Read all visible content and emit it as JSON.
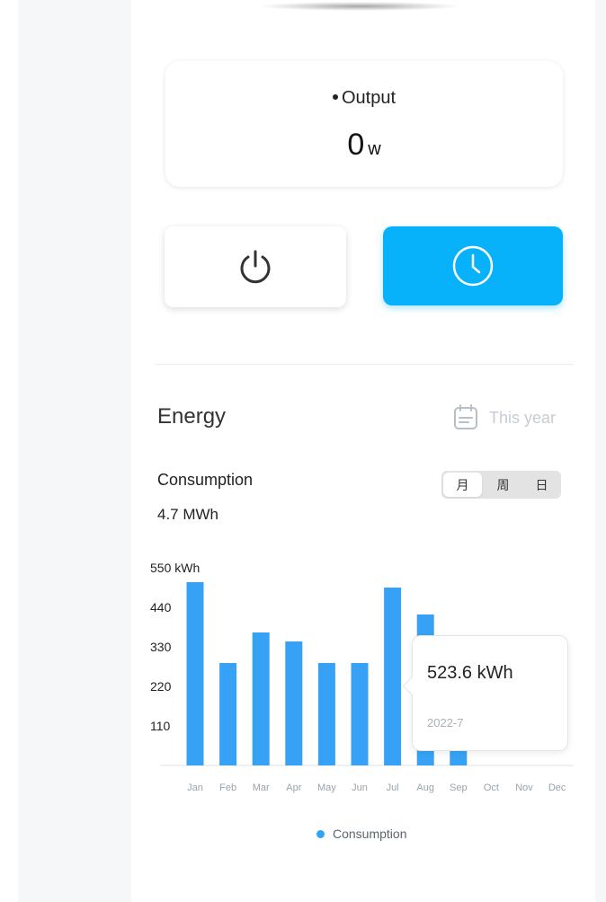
{
  "output": {
    "title": "Output",
    "value": "0",
    "unit": "w"
  },
  "controls": {
    "power_icon": "power-icon",
    "timer_icon": "clock-icon"
  },
  "energy": {
    "title": "Energy",
    "period_icon": "calendar-icon",
    "period_label": "This year",
    "consumption_label": "Consumption",
    "consumption_value": "4.7 MWh",
    "tabs": [
      "月",
      "周",
      "日"
    ],
    "active_tab": "月"
  },
  "chart_data": {
    "type": "bar",
    "categories": [
      "Jan",
      "Feb",
      "Mar",
      "Apr",
      "May",
      "Jun",
      "Jul",
      "Aug",
      "Sep",
      "Oct",
      "Nov",
      "Dec"
    ],
    "values": [
      510,
      285,
      370,
      345,
      285,
      285,
      495,
      420,
      100,
      0,
      0,
      0
    ],
    "y_unit": "550 kWh",
    "yticks": [
      "110",
      "220",
      "330",
      "440"
    ],
    "ylim": [
      0,
      550
    ],
    "legend": [
      "Consumption"
    ],
    "tooltip": {
      "value": "523.6 kWh",
      "date": "2022-7"
    },
    "colors": {
      "bar": "#37a2f5",
      "accent": "#07b2fb"
    }
  }
}
